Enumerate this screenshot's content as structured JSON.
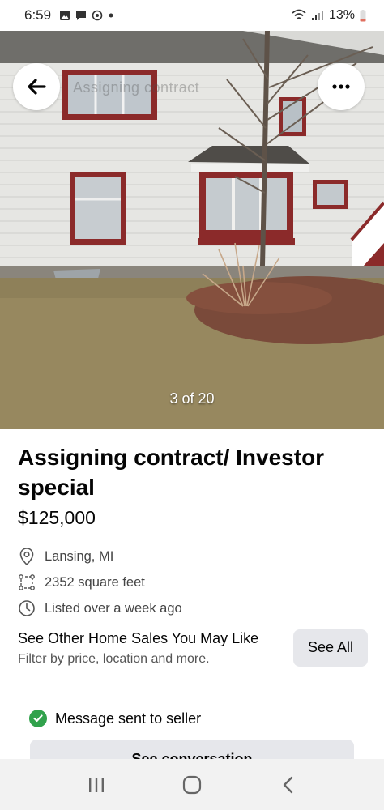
{
  "status_bar": {
    "time": "6:59",
    "battery": "13%",
    "icons": [
      "image-icon",
      "chat-icon",
      "messenger-icon",
      "dot-icon",
      "wifi-icon",
      "signal-icon",
      "battery-icon"
    ]
  },
  "photo": {
    "faded_title": "Assigning contract",
    "counter": "3 of 20"
  },
  "listing": {
    "title": "Assigning contract/ Investor special",
    "price": "$125,000",
    "location": "Lansing, MI",
    "area": "2352 square feet",
    "listed": "Listed over a week ago"
  },
  "promo": {
    "title": "See Other Home Sales You May Like",
    "subtitle": "Filter by price, location and more.",
    "button_label": "See All"
  },
  "message": {
    "status": "Message sent to seller",
    "button_label": "See conversation"
  },
  "colors": {
    "accent_gray": "#e6e7eb",
    "success_green": "#31a24c",
    "siding": "#e8e8e6",
    "trim": "#8b2a2a"
  }
}
